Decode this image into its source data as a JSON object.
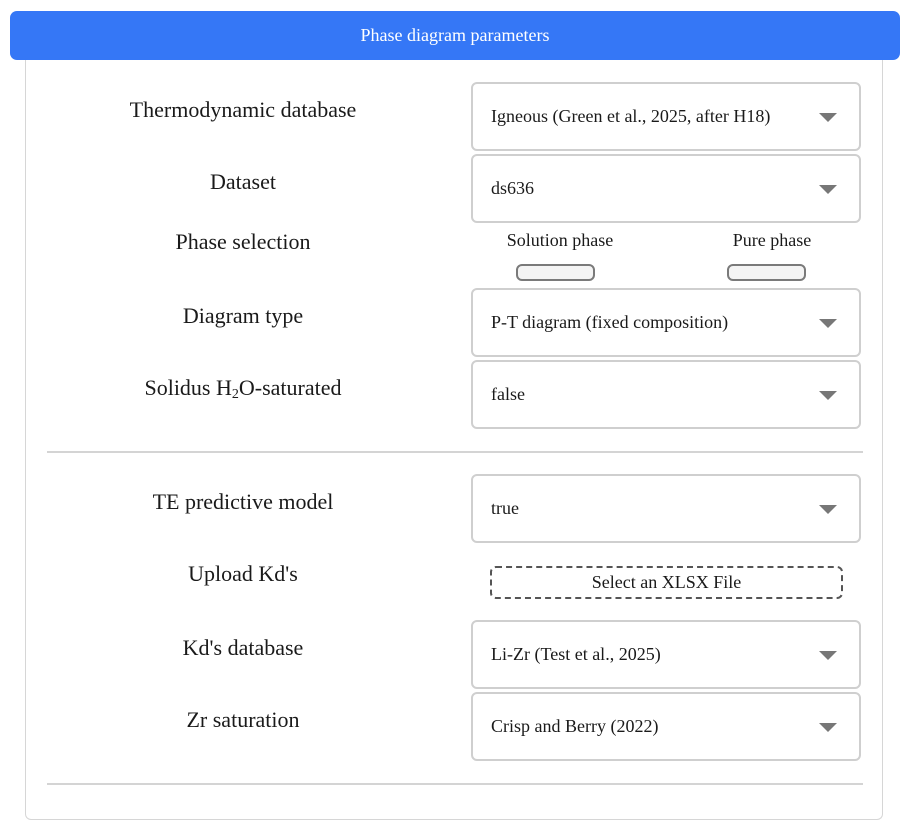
{
  "header": {
    "title": "Phase diagram parameters"
  },
  "params": {
    "thermo_db": {
      "label": "Thermodynamic database",
      "value": "Igneous (Green et al., 2025, after H18)"
    },
    "dataset": {
      "label": "Dataset",
      "value": "ds636"
    },
    "phase_selection": {
      "label": "Phase selection",
      "solution_label": "Solution phase",
      "pure_label": "Pure phase"
    },
    "diagram_type": {
      "label": "Diagram type",
      "value": "P-T diagram (fixed composition)"
    },
    "solidus": {
      "label_before": "Solidus H",
      "label_sub": "2",
      "label_after": "O-saturated",
      "value": "false"
    }
  },
  "te": {
    "model": {
      "label": "TE predictive model",
      "value": "true"
    },
    "upload": {
      "label": "Upload Kd's",
      "button": "Select an XLSX File"
    },
    "kd_db": {
      "label": "Kd's database",
      "value": "Li-Zr (Test et al., 2025)"
    },
    "zr_sat": {
      "label": "Zr saturation",
      "value": "Crisp and Berry (2022)"
    }
  }
}
